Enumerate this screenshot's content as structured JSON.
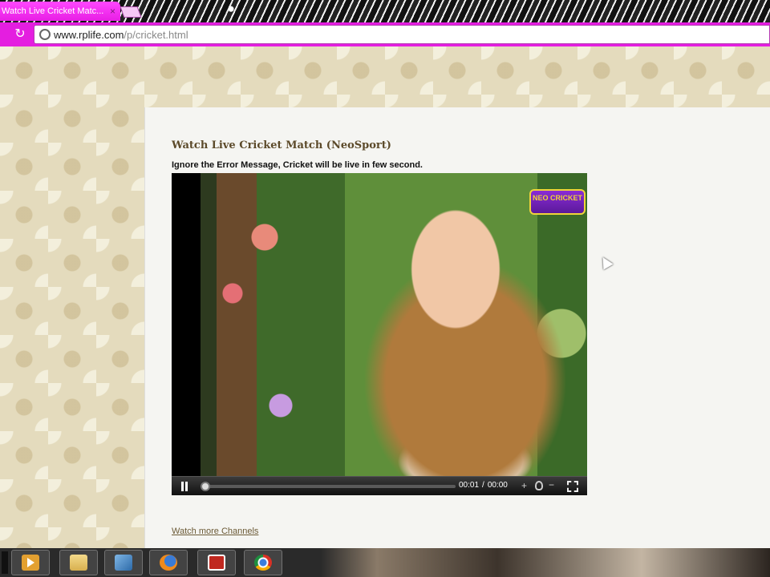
{
  "browser": {
    "tab_title": "Watch Live Cricket Matc...",
    "tab_close": "×",
    "url_host": "www.rplife.com",
    "url_path": "/p/cricket.html",
    "reload_glyph": "↻"
  },
  "post": {
    "title": "Watch Live Cricket Match (NeoSport)",
    "notice": "Ignore the Error Message, Cricket will be live in few second.",
    "more_link": "Watch more Channels"
  },
  "player": {
    "channel_logo": "NEO CRICKET",
    "current_time": "00:01",
    "time_separator": "/",
    "duration": "00:00",
    "volume_plus": "+",
    "volume_minus": "−"
  },
  "taskbar": {
    "items": [
      "media-player",
      "folder",
      "window",
      "firefox",
      "pdf-reader",
      "chrome"
    ]
  },
  "colors": {
    "tab_pink": "#e81ee4",
    "title_brown": "#5c4a2a",
    "page_bg": "#e4dbbd"
  }
}
